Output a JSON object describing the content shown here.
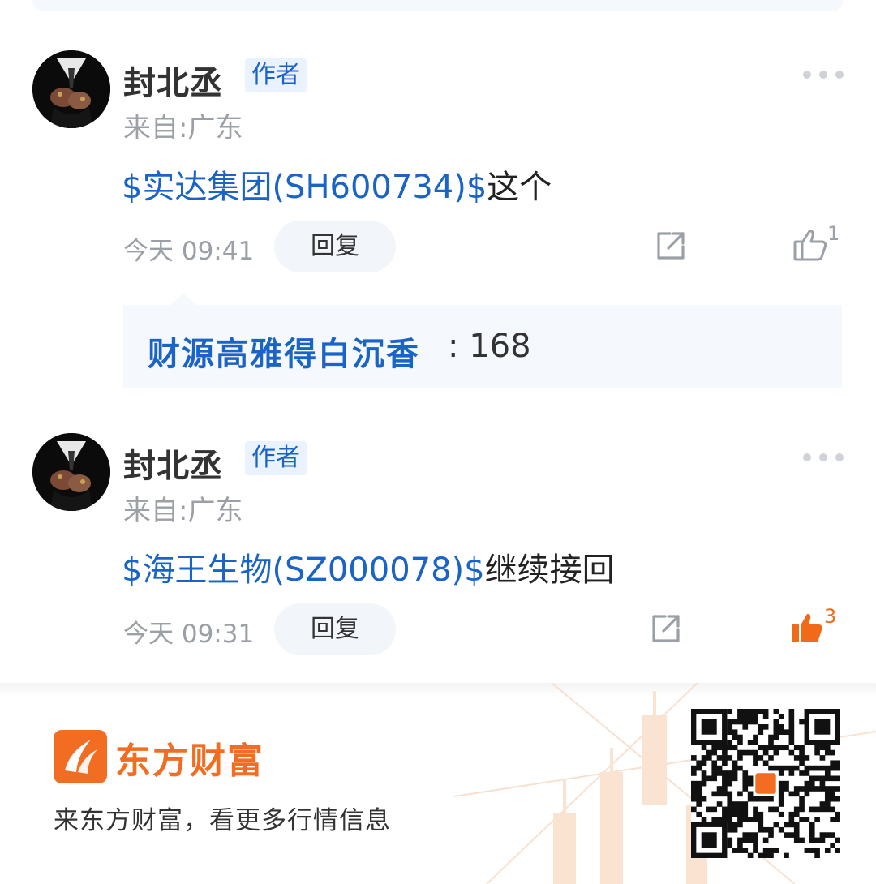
{
  "comments": [
    {
      "author": "封北丞",
      "tag": "作者",
      "location": "来自:广东",
      "stock": "$实达集团(SH600734)$",
      "text": "这个",
      "time": "今天 09:41",
      "reply_label": "回复",
      "likes": "1",
      "liked": false
    },
    {
      "author": "封北丞",
      "tag": "作者",
      "location": "来自:广东",
      "stock": "$海王生物(SZ000078)$",
      "text": "继续接回",
      "time": "今天 09:31",
      "reply_label": "回复",
      "likes": "3",
      "liked": true
    }
  ],
  "subreply": {
    "name": "财源高雅得白沉香",
    "count": ": 168"
  },
  "footer": {
    "brand": "东方财富",
    "slogan": "来东方财富，看更多行情信息"
  },
  "colors": {
    "link_blue": "#1a63c7",
    "brand_orange": "#f26d21",
    "muted_gray": "#9aa0a6"
  },
  "icons": {
    "more": "more-dots-icon",
    "share": "share-icon",
    "like": "thumbs-up-icon"
  }
}
